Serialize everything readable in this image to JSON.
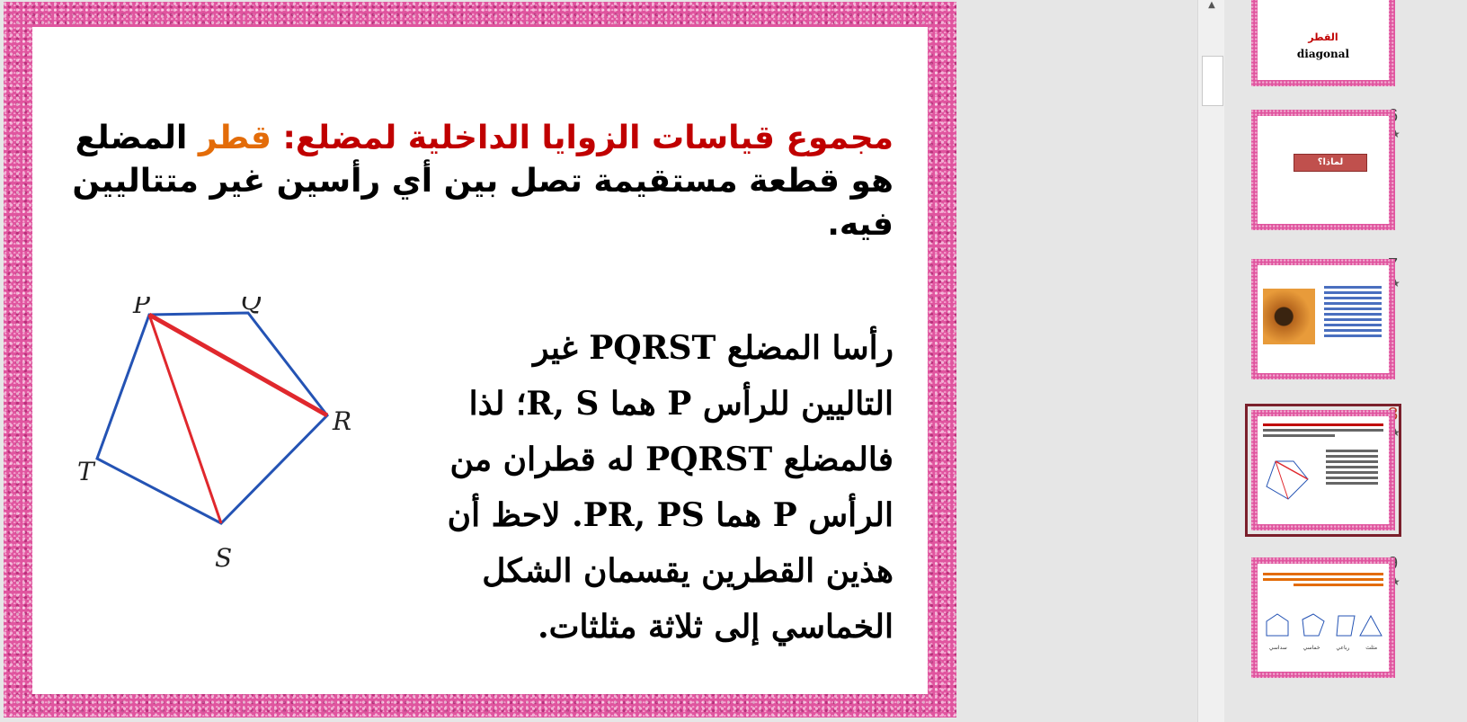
{
  "slide": {
    "title_red": "مجموع قياسات الزوايا الداخلية لمضلع:",
    "title_orange": "قطر",
    "title_black_1": "المضلع",
    "title_line_2": "هو قطعة مستقيمة تصل بين أي رأسين غير متتاليين",
    "title_line_3": "فيه.",
    "body_lines": [
      "رأسا المضلع PQRST غير",
      "التاليين للرأس P هما R, S؛ لذا",
      "فالمضلع PQRST له قطران من",
      "الرأس P هما PR, PS. لاحظ أن",
      "هذين القطرين يقسمان الشكل",
      "الخماسي إلى ثلاثة مثلثات."
    ],
    "diagram_labels": {
      "p": "P",
      "q": "Q",
      "r": "R",
      "s": "S",
      "t": "T"
    },
    "colors": {
      "outline": "#2453b4",
      "diagonal": "#e0282d"
    }
  },
  "scrollbar": {
    "up_arrow": "▲"
  },
  "thumbnails": [
    {
      "number": "",
      "title_red": "القطر",
      "subtitle": "diagonal",
      "selected": false
    },
    {
      "number": "6",
      "button_label": "لماذا؟",
      "selected": false
    },
    {
      "number": "7",
      "selected": false
    },
    {
      "number": "8",
      "selected": true
    },
    {
      "number": "9",
      "labels": [
        "سداسي",
        "خماسي",
        "رباعي",
        "مثلث"
      ],
      "selected": false
    }
  ],
  "star": "★"
}
